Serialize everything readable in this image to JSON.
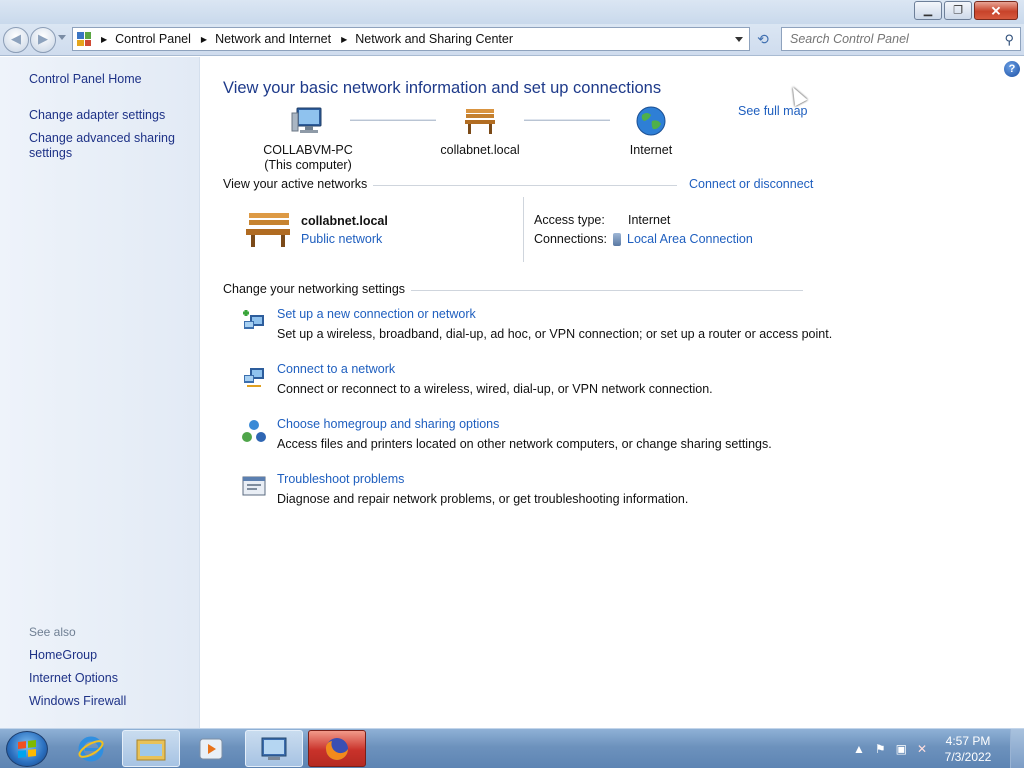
{
  "window": {
    "controls": {
      "minimize": "minimize-icon",
      "restore": "restore-icon",
      "close": "close-icon"
    }
  },
  "address": {
    "breadcrumbs": [
      "Control Panel",
      "Network and Internet",
      "Network and Sharing Center"
    ],
    "search_placeholder": "Search Control Panel"
  },
  "sidebar": {
    "home": "Control Panel Home",
    "links": [
      "Change adapter settings",
      "Change advanced sharing settings"
    ],
    "see_also_label": "See also",
    "see_also": [
      "HomeGroup",
      "Internet Options",
      "Windows Firewall"
    ]
  },
  "main": {
    "title": "View your basic network information and set up connections",
    "see_full_map": "See full map",
    "map": {
      "computer_name": "COLLABVM-PC",
      "computer_note": "(This computer)",
      "network": "collabnet.local",
      "internet": "Internet"
    },
    "active_networks": {
      "heading": "View your active networks",
      "connect_link": "Connect or disconnect",
      "name": "collabnet.local",
      "category": "Public network",
      "access_type_label": "Access type:",
      "access_type_value": "Internet",
      "connections_label": "Connections:",
      "connections_value": "Local Area Connection"
    },
    "settings": {
      "heading": "Change your networking settings",
      "tasks": [
        {
          "link": "Set up a new connection or network",
          "desc": "Set up a wireless, broadband, dial-up, ad hoc, or VPN connection; or set up a router or access point.",
          "icon": "new-connection-icon"
        },
        {
          "link": "Connect to a network",
          "desc": "Connect or reconnect to a wireless, wired, dial-up, or VPN network connection.",
          "icon": "connect-network-icon"
        },
        {
          "link": "Choose homegroup and sharing options",
          "desc": "Access files and printers located on other network computers, or change sharing settings.",
          "icon": "homegroup-icon"
        },
        {
          "link": "Troubleshoot problems",
          "desc": "Diagnose and repair network problems, or get troubleshooting information.",
          "icon": "troubleshoot-icon"
        }
      ]
    }
  },
  "taskbar": {
    "time": "4:57 PM",
    "date": "7/3/2022"
  }
}
